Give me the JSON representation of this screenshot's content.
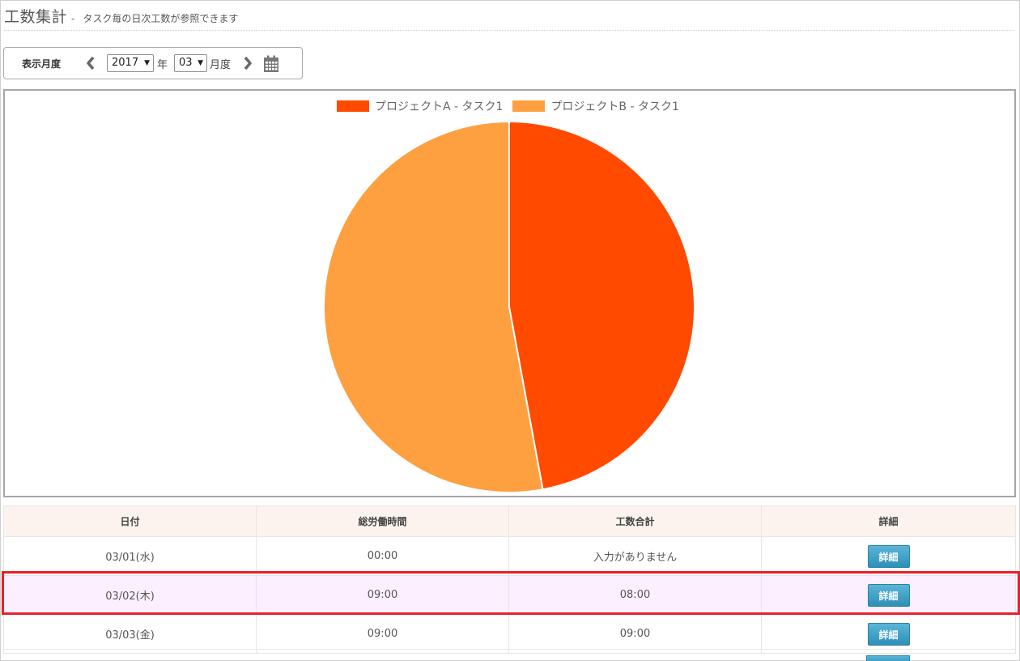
{
  "header": {
    "title": "工数集計",
    "separator": "-",
    "subtitle": "タスク毎の日次工数が参照できます"
  },
  "month_selector": {
    "label": "表示月度",
    "year_value": "2017",
    "year_unit": "年",
    "month_value": "03",
    "month_unit": "月度",
    "prev_icon": "chevron-left-icon",
    "next_icon": "chevron-right-icon",
    "calendar_icon": "calendar-icon"
  },
  "chart_data": {
    "type": "pie",
    "labels": [
      "プロジェクトA - タスク1",
      "プロジェクトB - タスク1"
    ],
    "values": [
      47.1,
      52.9
    ],
    "colors": [
      "#ff4a00",
      "#ffa040"
    ],
    "legend_position": "top-center"
  },
  "table": {
    "headers": [
      "日付",
      "総労働時間",
      "工数合計",
      "詳細"
    ],
    "rows": [
      {
        "date": "03/01(水)",
        "total": "00:00",
        "effort": "入力がありません",
        "detail": "詳細"
      },
      {
        "date": "03/02(木)",
        "total": "09:00",
        "effort": "08:00",
        "detail": "詳細"
      },
      {
        "date": "03/03(金)",
        "total": "09:00",
        "effort": "09:00",
        "detail": "詳細"
      }
    ]
  },
  "colors": {
    "accent_highlight": "#e8202a",
    "button": "#3a9cc4",
    "no_input_text": "#e02020"
  }
}
